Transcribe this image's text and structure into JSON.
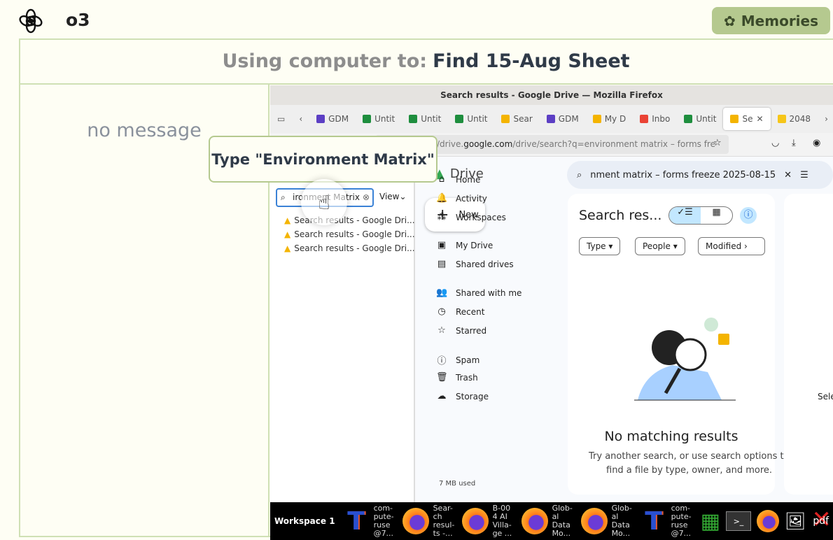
{
  "header": {
    "model": "o3",
    "memories_label": "Memories"
  },
  "task": {
    "prefix": "Using computer to:",
    "title": "Find 15-Aug Sheet"
  },
  "chat": {
    "empty": "no message"
  },
  "action_tooltip": "Type \"Environment Matrix\"",
  "browser": {
    "window_title": "Search results - Google Drive — Mozilla Firefox",
    "tabs": [
      {
        "label": "GDM",
        "color": "#5c3fc4"
      },
      {
        "label": "Untit",
        "color": "#1e8e3e"
      },
      {
        "label": "Untit",
        "color": "#1e8e3e"
      },
      {
        "label": "Untit",
        "color": "#1e8e3e"
      },
      {
        "label": "Sear",
        "color": "#f4b400"
      },
      {
        "label": "GDM",
        "color": "#5c3fc4"
      },
      {
        "label": "My D",
        "color": "#f4b400"
      },
      {
        "label": "Inbo",
        "color": "#ea4335"
      },
      {
        "label": "Untit",
        "color": "#1e8e3e"
      },
      {
        "label": "Se",
        "color": "#f4b400"
      },
      {
        "label": "2048",
        "color": "#f6c619"
      }
    ],
    "url_prefix": "/drive.",
    "url_domain": "google.com",
    "url_rest": "/drive/search?q=environment matrix – forms fre",
    "sidebar": {
      "search_value": "ironment Matrix",
      "view_label": "View",
      "results": [
        "Search results - Google Dri...",
        "Search results - Google Dri...",
        "Search results - Google Dri..."
      ]
    },
    "drive": {
      "logo_label": "Drive",
      "search_value": "nment matrix – forms freeze 2025-08-15",
      "new_label": "New",
      "nav": [
        "Home",
        "Activity",
        "Workspaces",
        "My Drive",
        "Shared drives",
        "Shared with me",
        "Recent",
        "Starred",
        "Spam",
        "Trash",
        "Storage"
      ],
      "storage_used": "7 MB used",
      "results_title": "Search res...",
      "filters": [
        "Type",
        "People",
        "Modified"
      ],
      "empty_title": "No matching results",
      "empty_text1": "Try another search, or use search options to",
      "empty_text2": "find a file by type, owner, and more.",
      "right_panel_text": "Sele"
    }
  },
  "taskbar": {
    "workspace": "Workspace 1",
    "items": [
      "com-pute-ruse @7...",
      "Sear-ch resul-ts -...",
      "B-00 4 AI Villa-ge ...",
      "Glob-al Data Mo...",
      "Glob-al Data Mo...",
      "com-pute-ruse @7..."
    ],
    "pdf_label": "pdf"
  }
}
